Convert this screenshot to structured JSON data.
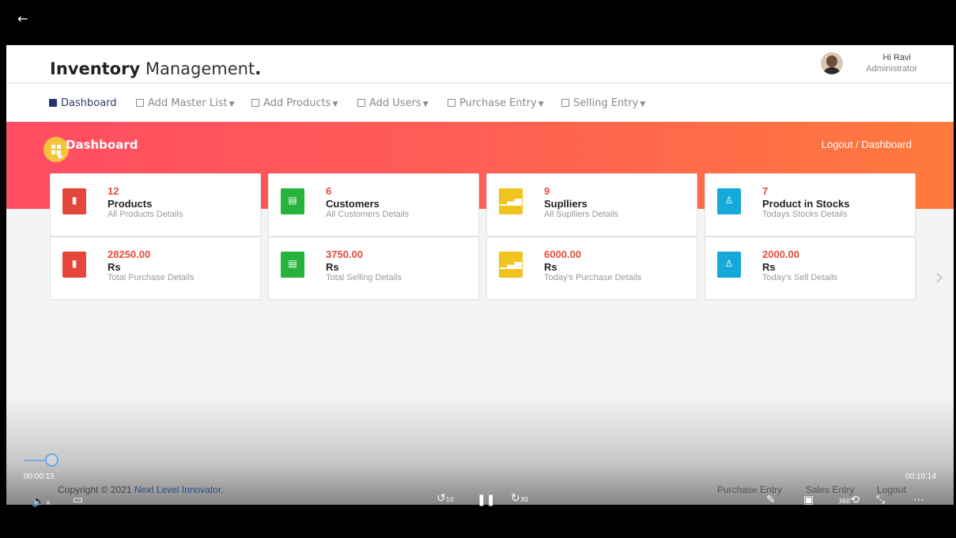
{
  "app": {
    "brand_bold": "Inventory",
    "brand_light": "Management",
    "brand_dot": ".",
    "user_greeting": "Hi Ravi",
    "user_role": "Administrator"
  },
  "nav": {
    "items": [
      {
        "label": "Dashboard",
        "active": true
      },
      {
        "label": "Add Master List"
      },
      {
        "label": "Add Products"
      },
      {
        "label": "Add Users"
      },
      {
        "label": "Purchase Entry"
      },
      {
        "label": "Selling Entry"
      }
    ]
  },
  "banner": {
    "title": "Dashboard",
    "breadcrumb": "Logout  /  Dashboard"
  },
  "cards": [
    {
      "count": "12",
      "label": "Products",
      "sub": "All Products Details",
      "color": "#e4463c",
      "icon": "file-icon"
    },
    {
      "count": "6",
      "label": "Customers",
      "sub": "All Customers Details",
      "color": "#25b33b",
      "icon": "list-icon"
    },
    {
      "count": "9",
      "label": "Suplliers",
      "sub": "All Suplliers Details",
      "color": "#f0c31d",
      "icon": "bar-chart-icon"
    },
    {
      "count": "7",
      "label": "Product in Stocks",
      "sub": "Todays Stocks Details",
      "color": "#14a9d8",
      "icon": "user-icon"
    },
    {
      "count": "28250.00",
      "label": "Rs",
      "sub": "Total Purchase Details",
      "color": "#e4463c",
      "icon": "file-icon"
    },
    {
      "count": "3750.00",
      "label": "Rs",
      "sub": "Total Selling Details",
      "color": "#25b33b",
      "icon": "list-icon"
    },
    {
      "count": "6000.00",
      "label": "Rs",
      "sub": "Today's Purchase Details",
      "color": "#f0c31d",
      "icon": "bar-chart-icon"
    },
    {
      "count": "2000.00",
      "label": "Rs",
      "sub": "Today's Sell Details",
      "color": "#14a9d8",
      "icon": "user-icon"
    }
  ],
  "footer": {
    "copyright": "Copyright © 2021 ",
    "company": "Next Level Innovator",
    "copyright_end": ".",
    "links": [
      "Purchase Entry",
      "Sales Entry",
      "Logout"
    ]
  },
  "player": {
    "elapsed": "00:00:15",
    "total": "00:10:14",
    "progress": 0.024,
    "rewind_seconds": "10",
    "forward_seconds": "30",
    "view_360": "360"
  }
}
